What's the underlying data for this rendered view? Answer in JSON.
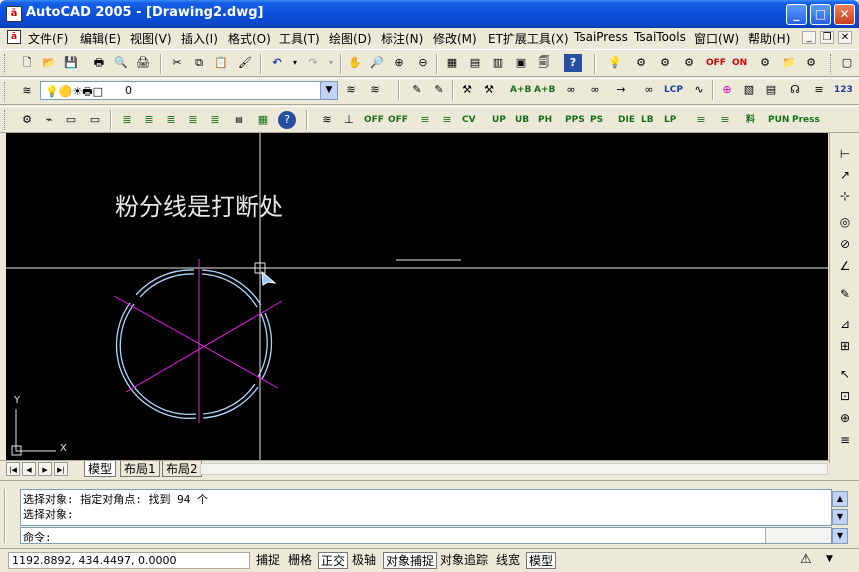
{
  "window": {
    "title": "AutoCAD 2005 - [Drawing2.dwg]",
    "app_icon": "autocad-icon"
  },
  "menu": [
    "文件(F)",
    "编辑(E)",
    "视图(V)",
    "插入(I)",
    "格式(O)",
    "工具(T)",
    "绘图(D)",
    "标注(N)",
    "修改(M)",
    "ET扩展工具(X)",
    "TsaiPress",
    "TsaiTools",
    "窗口(W)",
    "帮助(H)"
  ],
  "layer": {
    "current": "0"
  },
  "toolbar3_labels": [
    "OFF",
    "OFF",
    "CV",
    "UP",
    "UB",
    "PH",
    "PPS",
    "PS",
    "DIE",
    "LB",
    "LP",
    "料",
    "PUN",
    "Press"
  ],
  "toolbar2_labels": [
    "A+B",
    "A+B",
    "LCP",
    "123"
  ],
  "toolbar1_labels": [
    "OFF",
    "ON"
  ],
  "drawing": {
    "annotation": "粉分线是打断处",
    "ucs_x": "X",
    "ucs_y": "Y"
  },
  "layout_tabs": [
    "模型",
    "布局1",
    "布局2"
  ],
  "command": {
    "history": [
      "选择对象: 指定对角点: 找到 94 个",
      "选择对象:"
    ],
    "prompt": "命令:"
  },
  "status": {
    "coords": "1192.8892, 434.4497, 0.0000",
    "toggles": [
      "捕捉",
      "栅格",
      "正交",
      "极轴",
      "对象捕捉",
      "对象追踪",
      "线宽",
      "模型"
    ],
    "on": [
      "正交",
      "对象捕捉",
      "模型"
    ]
  },
  "colors": {
    "canvas": "#000000",
    "circle": "#b0d8ff",
    "spokes": "#e020e0",
    "crosshair": "#ffffff"
  }
}
